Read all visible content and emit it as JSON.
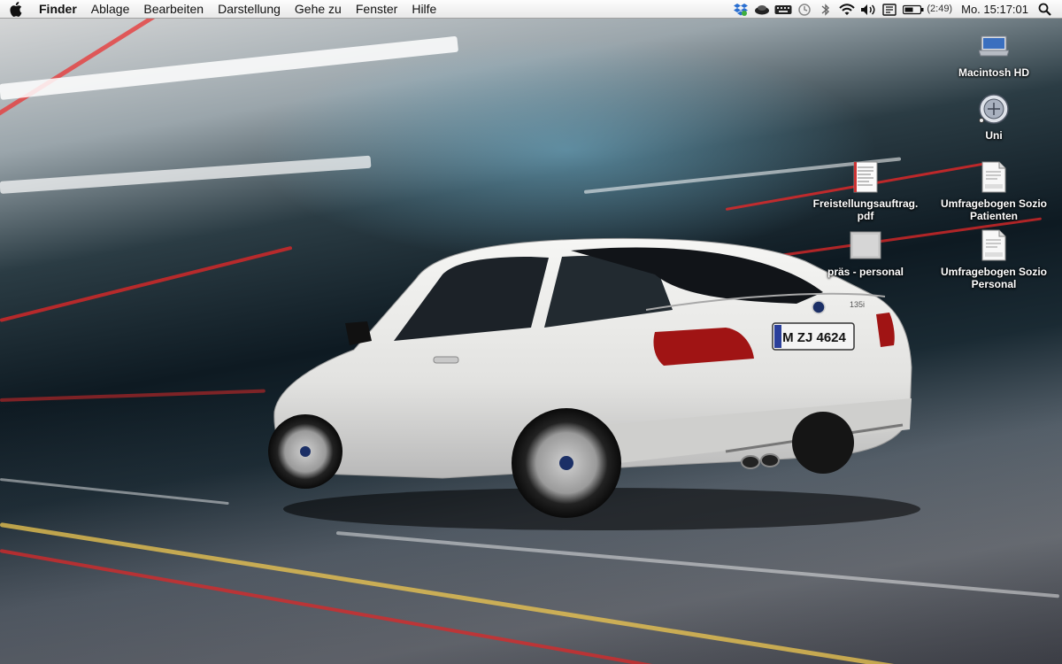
{
  "menubar": {
    "app_name": "Finder",
    "items": [
      "Ablage",
      "Bearbeiten",
      "Darstellung",
      "Gehe zu",
      "Fenster",
      "Hilfe"
    ],
    "battery_time": "(2:49)",
    "clock": "Mo. 15:17:01"
  },
  "wallpaper": {
    "license_plate": "M ZJ 4624",
    "badge": "135i"
  },
  "desktop_icons": [
    {
      "label": "Macintosh HD",
      "icon": "hard-drive-icon"
    },
    {
      "label": "Uni",
      "icon": "folder-seal-icon"
    },
    {
      "label": "Freistellungsauftrag.\npdf",
      "icon": "pdf-document-icon"
    },
    {
      "label": "Umfragebogen Sozio\nPatienten",
      "icon": "pages-document-icon"
    },
    {
      "label": "präs - personal",
      "icon": "keynote-document-icon"
    },
    {
      "label": "Umfragebogen Sozio\nPersonal",
      "icon": "pages-document-icon"
    }
  ],
  "colors": {
    "menubar_bg": "#ececec",
    "label_text": "#ffffff",
    "car_body": "#e8e8e6",
    "taillight": "#b01818"
  }
}
